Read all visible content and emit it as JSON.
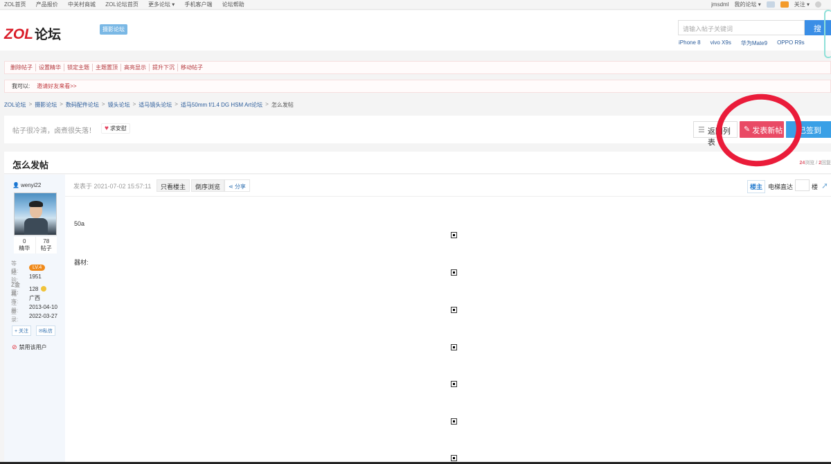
{
  "topbar": {
    "links": [
      "ZOL首页",
      "产品报价",
      "中关村商城",
      "ZOL论坛首页",
      "更多论坛 ▾",
      "手机客户端",
      "论坛帮助"
    ],
    "user": "jmsdml",
    "my_forum": "我的论坛 ▾",
    "follow": "关注 ▾"
  },
  "header": {
    "logo_zol": "ZOL",
    "logo_text": "论坛",
    "forum_tag": "摄影论坛",
    "search_placeholder": "请输入帖子关键词",
    "search_button": "搜",
    "hotwords": [
      "iPhone 8",
      "vivo X9s",
      "华为Mate9",
      "OPPO R9s"
    ]
  },
  "admin": {
    "actions": [
      "删除帖子",
      "设置精华",
      "锁定主题",
      "主题置顶",
      "高亮显示",
      "提升下沉",
      "移动帖子"
    ],
    "invite_label": "我可以:",
    "invite_link": "邀请好友来看>>"
  },
  "breadcrumb": [
    "ZOL论坛",
    "摄影论坛",
    "数码配件论坛",
    "镜头论坛",
    "适马镜头论坛",
    "适马50mm f/1.4 DG HSM Art论坛",
    "怎么发帖"
  ],
  "action_bar": {
    "slogan": "帖子很冷清，卤煮很失落！",
    "help_button": "求安慰",
    "back_button": "返回列表",
    "new_post_button": "发表新帖",
    "checkin_button": "已签到"
  },
  "thread": {
    "title": "怎么发帖",
    "views": "24",
    "views_label": "浏览",
    "replies": "2",
    "replies_label": "回复"
  },
  "author": {
    "username": "wenyi22",
    "digest_count": "0",
    "digest_label": "精华",
    "post_count": "78",
    "post_label": "帖子",
    "level_label": "等　级:",
    "level": "LV.4",
    "exp_label": "经　验:",
    "exp": "1951",
    "coin_label": "Z金豆:",
    "coins": "128",
    "city_label": "城　市:",
    "city": "广西",
    "reg_label": "注　册:",
    "reg_date": "2013-04-10",
    "login_label": "登　录:",
    "login_date": "2022-03-27",
    "follow_button": "+ 关注",
    "message_button": "私信",
    "ban_text": "禁用该用户"
  },
  "post": {
    "time": "发表于 2021-07-02 15:57:11",
    "only_author": "只看楼主",
    "reverse": "倒序浏览",
    "share": "分享",
    "floor_main": "楼主",
    "elevator": "电梯直达",
    "floor_label": "楼",
    "line1": "50a",
    "line2": "器材:"
  }
}
